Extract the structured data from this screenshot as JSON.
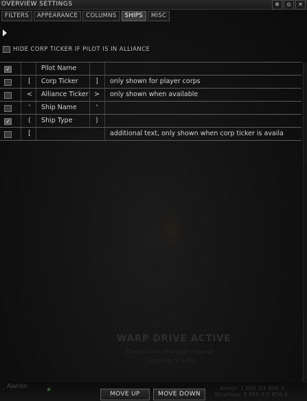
{
  "window": {
    "title": "OVERVIEW SETTINGS",
    "controls": [
      "✲",
      "⊙",
      "✕"
    ]
  },
  "tabs": [
    {
      "label": "FILTERS",
      "active": false
    },
    {
      "label": "APPEARANCE",
      "active": false
    },
    {
      "label": "COLUMNS",
      "active": false
    },
    {
      "label": "SHIPS",
      "active": true
    },
    {
      "label": "MISC",
      "active": false
    }
  ],
  "options": {
    "hide_corp_ticker": {
      "label": "HIDE CORP TICKER IF PILOT IS IN ALLIANCE",
      "checked": false
    }
  },
  "ship_label_rows": [
    {
      "checked": true,
      "pre": "",
      "name": "Pilot Name",
      "post": "",
      "description": ""
    },
    {
      "checked": false,
      "pre": "[",
      "name": "Corp Ticker",
      "post": "]",
      "description": "only shown for player corps"
    },
    {
      "checked": false,
      "pre": "<",
      "name": "Alliance Ticker",
      "post": ">",
      "description": "only shown when available"
    },
    {
      "checked": false,
      "pre": "'",
      "name": "Ship Name",
      "post": "'",
      "description": ""
    },
    {
      "checked": true,
      "pre": "(",
      "name": "Ship Type",
      "post": ")",
      "description": ""
    },
    {
      "checked": false,
      "pre": "[",
      "name": "",
      "post": "",
      "description": "additional text, only shown when corp ticker is availa"
    }
  ],
  "background_hud": {
    "warp_title": "WARP DRIVE ACTIVE",
    "warp_line1": "Destination: Stargate (Vwera)",
    "warp_line2": "Distance: 9.5 AU",
    "pilot_name": "Alarion",
    "armor": "Armor: 1 856.3/1 856.3",
    "structure": "Structure: 1 856.3/1 856.3"
  },
  "buttons": {
    "move_up": "MOVE UP",
    "move_down": "MOVE DOWN"
  }
}
